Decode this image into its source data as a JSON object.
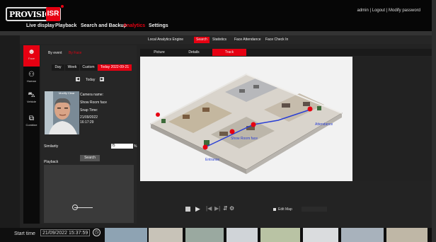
{
  "header": {
    "logo_text": "PROVISION",
    "logo_badge": "ISR",
    "nav": [
      {
        "label": "Live display",
        "active": false
      },
      {
        "label": "Playback",
        "active": false
      },
      {
        "label": "Search and Backup",
        "active": false
      },
      {
        "label": "Analytics",
        "active": true
      },
      {
        "label": "Settings",
        "active": false
      }
    ],
    "user_links": "admin | Logout | Modify password"
  },
  "top_tabs": [
    {
      "label": "Local Analytics Engine",
      "active": false
    },
    {
      "label": "Search",
      "active": true
    },
    {
      "label": "Statistics",
      "active": false
    },
    {
      "label": "Face Attendance",
      "active": false
    },
    {
      "label": "Face Check In",
      "active": false
    }
  ],
  "left_menu": [
    {
      "label": "Face",
      "icon": "face-icon",
      "active": true
    },
    {
      "label": "Human",
      "icon": "human-icon",
      "active": false
    },
    {
      "label": "Vehicle",
      "icon": "vehicle-icon",
      "active": false
    },
    {
      "label": "Combine",
      "icon": "combine-icon",
      "active": false
    }
  ],
  "filter": {
    "by_event": "By event",
    "by_event_value": "By Face",
    "date_tabs": [
      {
        "label": "Day",
        "active": false
      },
      {
        "label": "Week",
        "active": false
      },
      {
        "label": "Custom",
        "active": false
      },
      {
        "label": "Today 2022-09-21",
        "active": true
      }
    ],
    "today_label": "Today",
    "modify_clear": "Modify Clear",
    "camera_name_label": "Camera name:",
    "camera_name": "Show Room face",
    "snap_time_label": "Snap Time:",
    "snap_date": "21/09/2022",
    "snap_time": "16:17:29",
    "similarity_label": "Similarity",
    "similarity_value": "75",
    "similarity_unit": "%",
    "search_button": "Search",
    "playback_label": "Playback"
  },
  "map_tabs": [
    {
      "label": "Picture",
      "active": false
    },
    {
      "label": "Details",
      "active": false
    },
    {
      "label": "Track",
      "active": true
    }
  ],
  "map_labels": [
    "Attendance",
    "Show Room face",
    "Entrance"
  ],
  "map_controls": {
    "edit_map": "Edit Map"
  },
  "bottom": {
    "start_time_label": "Start time",
    "start_time_value": "21/09/2022 15:37:59"
  },
  "colors": {
    "accent": "#e60012",
    "background": "#1c1c1c",
    "map_bg": "#f2f2f2",
    "track_line": "#2a3fd4"
  }
}
